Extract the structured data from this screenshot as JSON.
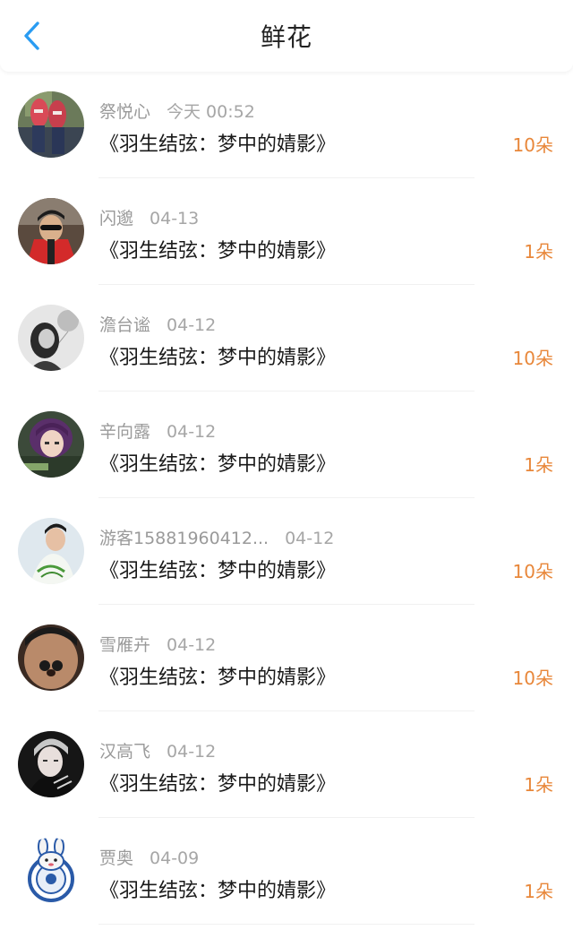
{
  "header": {
    "title": "鲜花",
    "back_icon": "chevron-left-icon",
    "accent_color": "#2a9cf2"
  },
  "count_color": "#e8873a",
  "items": [
    {
      "name": "祭悦心",
      "time": "今天 00:52",
      "book": "《羽生结弦：梦中的婧影》",
      "count": "10朵",
      "avatar": "photo-sneakers"
    },
    {
      "name": "闪邈",
      "time": "04-13",
      "book": "《羽生结弦：梦中的婧影》",
      "count": "1朵",
      "avatar": "photo-red-jacket-sunglasses"
    },
    {
      "name": "澹台谧",
      "time": "04-12",
      "book": "《羽生结弦：梦中的婧影》",
      "count": "10朵",
      "avatar": "photo-bw-girl-balloon"
    },
    {
      "name": "辛向露",
      "time": "04-12",
      "book": "《羽生结弦：梦中的婧影》",
      "count": "1朵",
      "avatar": "photo-purple-hair"
    },
    {
      "name": "游客15881960412...",
      "time": "04-12",
      "book": "《羽生结弦：梦中的婧影》",
      "count": "10朵",
      "avatar": "photo-skater"
    },
    {
      "name": "雪雁卉",
      "time": "04-12",
      "book": "《羽生结弦：梦中的婧影》",
      "count": "10朵",
      "avatar": "photo-face-closeup"
    },
    {
      "name": "汉高飞",
      "time": "04-12",
      "book": "《羽生结弦：梦中的婧影》",
      "count": "1朵",
      "avatar": "photo-young-man-dark"
    },
    {
      "name": "贾奥",
      "time": "04-09",
      "book": "《羽生结弦：梦中的婧影》",
      "count": "1朵",
      "avatar": "cartoon-bunny-badge"
    }
  ]
}
